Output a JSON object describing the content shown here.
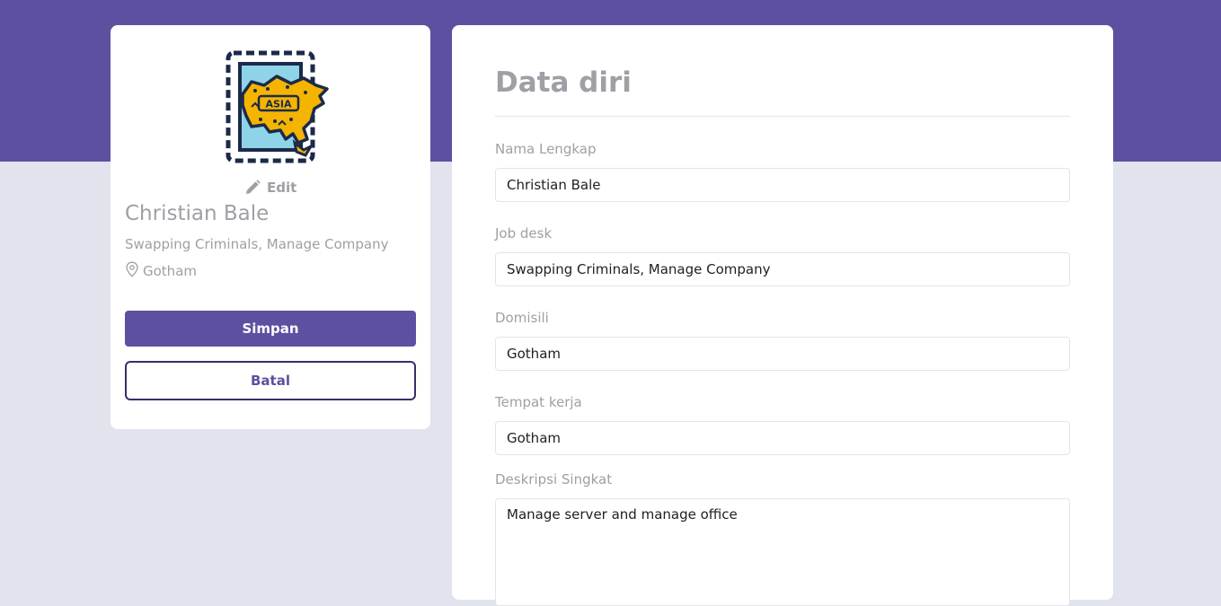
{
  "colors": {
    "brand": "#5e50a1",
    "background": "#e1e3ed",
    "muted_text": "#9ea0a5"
  },
  "profile": {
    "avatar_icon": "asia-stamp-icon",
    "avatar_text": "ASIA",
    "edit_label": "Edit",
    "name": "Christian Bale",
    "job": "Swapping Criminals, Manage Company",
    "location": "Gotham",
    "save_label": "Simpan",
    "cancel_label": "Batal"
  },
  "form": {
    "title": "Data diri",
    "fields": [
      {
        "label": "Nama Lengkap",
        "value": "Christian Bale"
      },
      {
        "label": "Job desk",
        "value": "Swapping Criminals, Manage Company"
      },
      {
        "label": "Domisili",
        "value": "Gotham"
      },
      {
        "label": "Tempat kerja",
        "value": "Gotham"
      },
      {
        "label": "Deskripsi Singkat",
        "value": "Manage server and manage office"
      }
    ]
  }
}
